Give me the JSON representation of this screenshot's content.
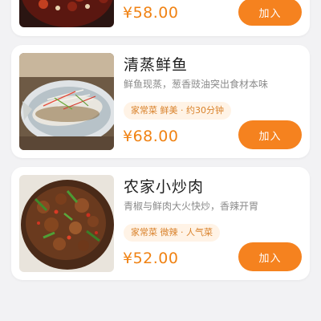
{
  "menu": {
    "items": [
      {
        "price": "¥58.00",
        "add_label": "加入"
      },
      {
        "name": "清蒸鲜鱼",
        "description": "鲜鱼现蒸，葱香豉油突出食材本味",
        "tags": "家常菜  鲜美 · 约30分钟",
        "price": "¥68.00",
        "add_label": "加入"
      },
      {
        "name": "农家小炒肉",
        "description": "青椒与鲜肉大火快炒，香辣开胃",
        "tags": "家常菜  微辣 · 人气菜",
        "price": "¥52.00",
        "add_label": "加入"
      }
    ]
  },
  "colors": {
    "accent": "#f5821f",
    "price": "#f08213",
    "tag_bg": "#fff3e6",
    "tag_text": "#d9822b",
    "page_bg": "#f2f2f4"
  }
}
